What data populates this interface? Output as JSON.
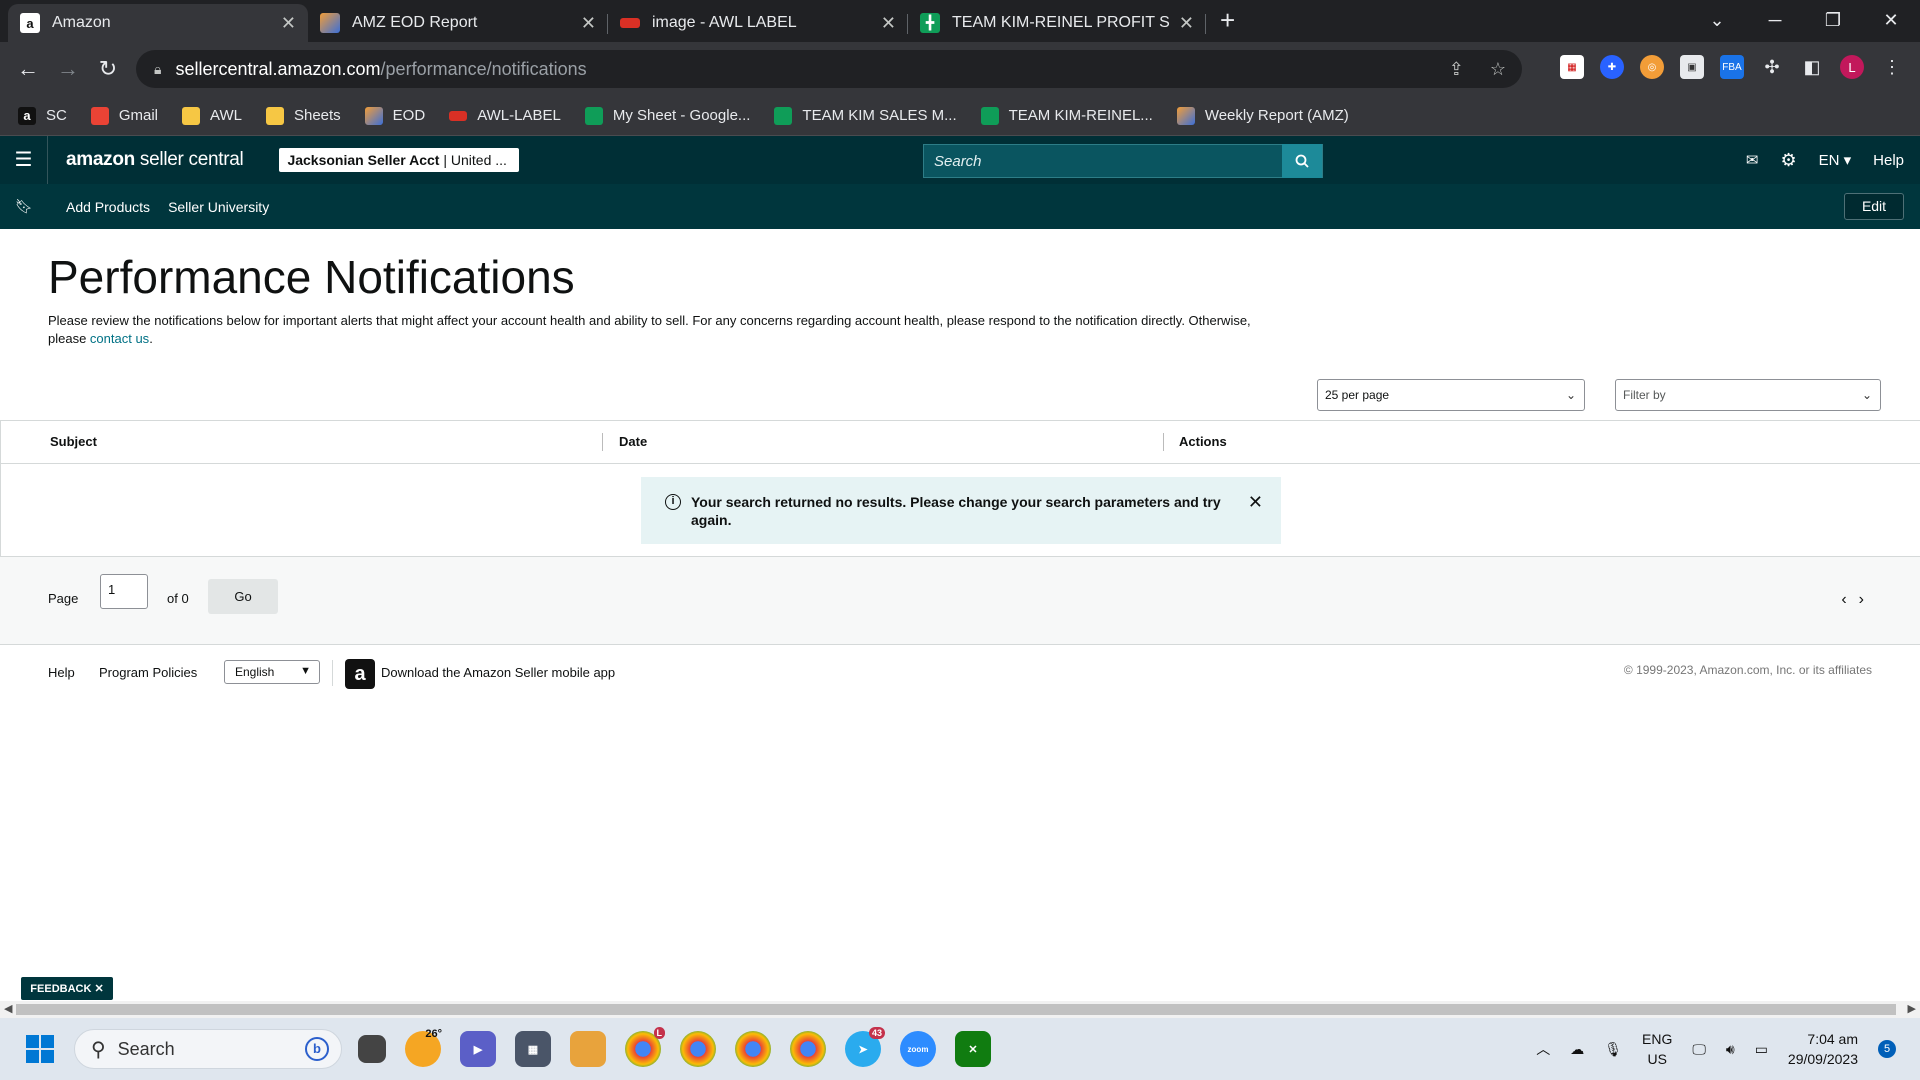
{
  "browser": {
    "tabs": [
      {
        "title": "Amazon",
        "active": true,
        "favicon": "amazon-icon"
      },
      {
        "title": "AMZ EOD Report",
        "active": false,
        "favicon": "report-icon"
      },
      {
        "title": "image - AWL LABEL",
        "active": false,
        "favicon": "awl-icon"
      },
      {
        "title": "TEAM KIM-REINEL PROFIT SHEE",
        "active": false,
        "favicon": "sheets-icon"
      }
    ],
    "url_host": "sellercentral.amazon.com",
    "url_path": "/performance/notifications",
    "profile_initial": "L",
    "bookmarks": [
      {
        "label": "SC",
        "icon": "amazon-icon",
        "color": "#111111"
      },
      {
        "label": "Gmail",
        "icon": "gmail-icon",
        "color": "#ea4335"
      },
      {
        "label": "AWL",
        "icon": "folder-icon",
        "color": "#f6c744"
      },
      {
        "label": "Sheets",
        "icon": "folder-icon",
        "color": "#f6c744"
      },
      {
        "label": "EOD",
        "icon": "report-icon",
        "color": "#f29d38"
      },
      {
        "label": "AWL-LABEL",
        "icon": "awl-icon",
        "color": "#d93025"
      },
      {
        "label": "My Sheet - Google...",
        "icon": "sheets-icon",
        "color": "#0f9d58"
      },
      {
        "label": "TEAM KIM SALES M...",
        "icon": "sheets-icon",
        "color": "#0f9d58"
      },
      {
        "label": "TEAM KIM-REINEL...",
        "icon": "sheets-icon",
        "color": "#0f9d58"
      },
      {
        "label": "Weekly Report (AMZ)",
        "icon": "report-icon",
        "color": "#f29d38"
      }
    ]
  },
  "header": {
    "logo_bold": "amazon",
    "logo_rest": " seller central",
    "account_name": "Jacksonian Seller Acct",
    "account_region": " | United ...",
    "search_placeholder": "Search",
    "language": "EN",
    "help": "Help"
  },
  "subnav": {
    "links": [
      "Add Products",
      "Seller University"
    ],
    "edit": "Edit"
  },
  "page": {
    "title": "Performance Notifications",
    "description": "Please review the notifications below for important alerts that might affect your account health and ability to sell. For any concerns regarding account health, please respond to the notification directly. Otherwise, please ",
    "contact_link": "contact us",
    "description_end": ".",
    "per_page": "25 per page",
    "filter_placeholder": "Filter by"
  },
  "table": {
    "columns": [
      "Subject",
      "Date",
      "Actions"
    ],
    "empty_message": "Your search returned no results. Please change your search parameters and try again."
  },
  "pager": {
    "page_label": "Page",
    "page_value": "1",
    "of_label": "of 0",
    "go": "Go"
  },
  "footer": {
    "help": "Help",
    "policies": "Program Policies",
    "language": "English",
    "app_text": "Download the Amazon Seller mobile app",
    "copyright": "© 1999-2023, Amazon.com, Inc. or its affiliates"
  },
  "feedback": "FEEDBACK",
  "taskbar": {
    "search": "Search",
    "weather": "26°",
    "input_lang": "ENG",
    "input_region": "US",
    "time": "7:04 am",
    "date": "29/09/2023",
    "notifications": "5",
    "telegram_badge": "43"
  },
  "colors": {
    "header_bg": "#002f36",
    "subnav_bg": "#00363d",
    "link": "#007185",
    "alert_bg": "#e6f3f4"
  }
}
